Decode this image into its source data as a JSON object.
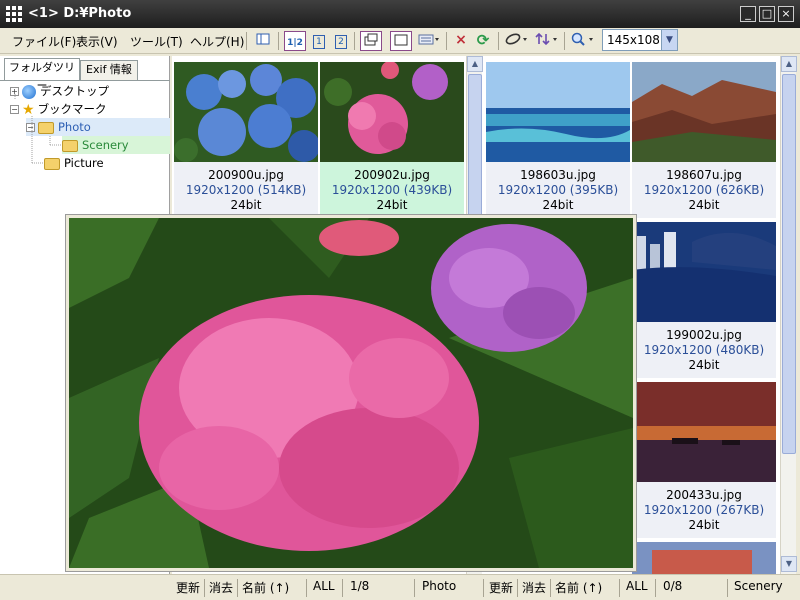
{
  "window": {
    "title": "<1>  D:¥Photo",
    "minimize": "_",
    "maximize": "□",
    "close": "×"
  },
  "menu": [
    "ファイル(F)",
    "表示(V)",
    "ツール(T)",
    "ヘルプ(H)"
  ],
  "toolbar": {
    "view_buttons": [
      "1|2",
      "1",
      "2"
    ],
    "thumb_size": "145x108"
  },
  "left_tabs": [
    "フォルダツリー",
    "Exif 情報"
  ],
  "tree": {
    "desktop": "デスクトップ",
    "bookmark": "ブックマーク",
    "photo": "Photo",
    "scenery": "Scenery",
    "picture": "Picture"
  },
  "pane1": {
    "items": [
      {
        "name": "200900u.jpg",
        "dims": "1920x1200 (514KB)",
        "bits": "24bit"
      },
      {
        "name": "200902u.jpg",
        "dims": "1920x1200 (439KB)",
        "bits": "24bit"
      }
    ]
  },
  "pane2": {
    "items": [
      {
        "name": "198603u.jpg",
        "dims": "1920x1200 (395KB)",
        "bits": "24bit"
      },
      {
        "name": "198607u.jpg",
        "dims": "1920x1200 (626KB)",
        "bits": "24bit"
      },
      {
        "name": "199002u.jpg",
        "dims": "1920x1200 (480KB)",
        "bits": "24bit"
      },
      {
        "name": "200433u.jpg",
        "dims": "1920x1200 (267KB)",
        "bits": "24bit"
      }
    ]
  },
  "status": {
    "left": {
      "refresh": "更新",
      "clear": "消去",
      "sort": "名前 (↑)",
      "filter": "ALL",
      "count": "1/8",
      "folder": "Photo"
    },
    "right": {
      "refresh": "更新",
      "clear": "消去",
      "sort": "名前 (↑)",
      "filter": "ALL",
      "count": "0/8",
      "folder": "Scenery"
    }
  },
  "colors": {
    "selected_caption": "#cdf5dc",
    "caption": "#eef0f6",
    "dims_text": "#2b4f98"
  }
}
